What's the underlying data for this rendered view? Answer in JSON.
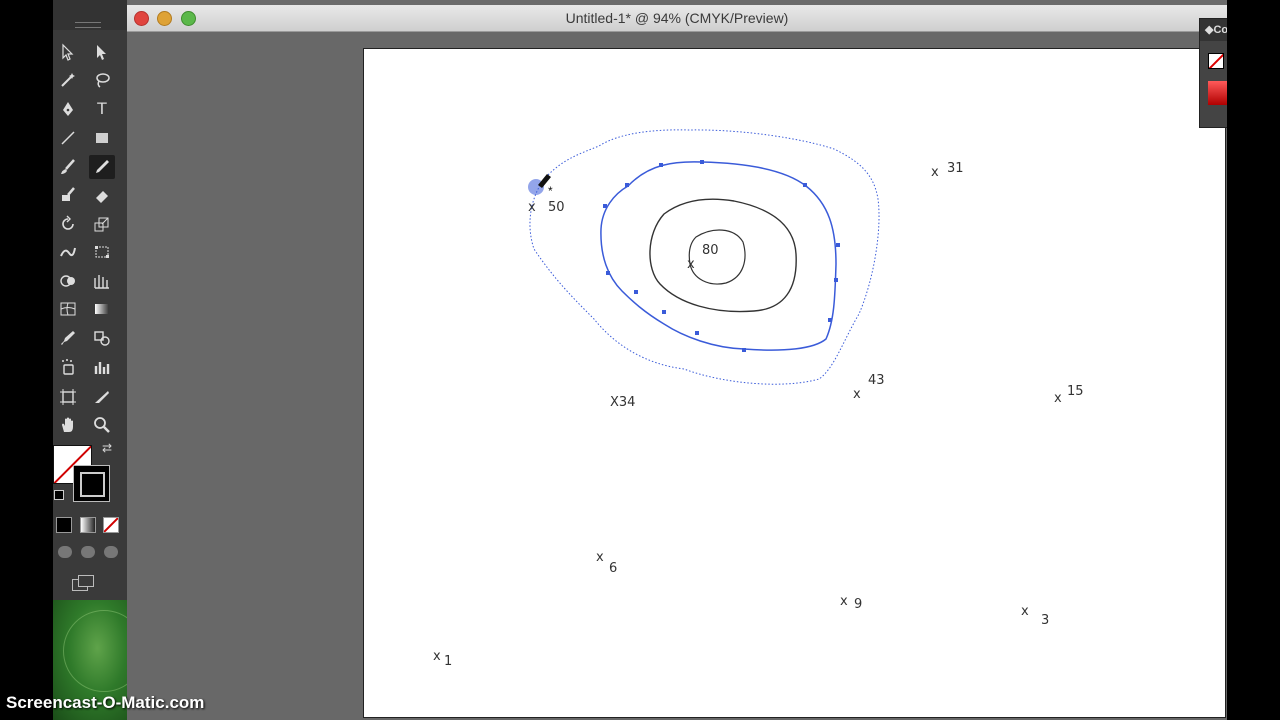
{
  "window": {
    "title": "Untitled-1* @ 94% (CMYK/Preview)"
  },
  "tools": [
    "selection-tool",
    "direct-selection-tool",
    "magic-wand-tool",
    "lasso-tool",
    "pen-tool",
    "type-tool",
    "line-tool",
    "rectangle-tool",
    "paintbrush-tool",
    "pencil-tool",
    "blob-brush-tool",
    "eraser-tool",
    "rotate-tool",
    "scale-tool",
    "warp-tool",
    "free-transform-tool",
    "shape-builder-tool",
    "perspective-grid-tool",
    "mesh-tool",
    "gradient-tool",
    "eyedropper-tool",
    "blend-tool",
    "symbol-sprayer-tool",
    "column-graph-tool",
    "artboard-tool",
    "slice-tool",
    "hand-tool",
    "zoom-tool"
  ],
  "tool_glyphs": {
    "type": "T"
  },
  "color_panel": {
    "title": "Co"
  },
  "canvas": {
    "labels": {
      "p50": "50",
      "p80": "80",
      "p31": "31",
      "p34": "X34",
      "p43": "43",
      "p15": "15",
      "p6": "6",
      "p9": "9",
      "p3": "3",
      "p1": "1"
    }
  },
  "colors": {
    "selection": "#3a5bd9",
    "stroke": "#333333",
    "fill_none_slash": "#d00000"
  },
  "watermark": "Screencast-O-Matic.com"
}
